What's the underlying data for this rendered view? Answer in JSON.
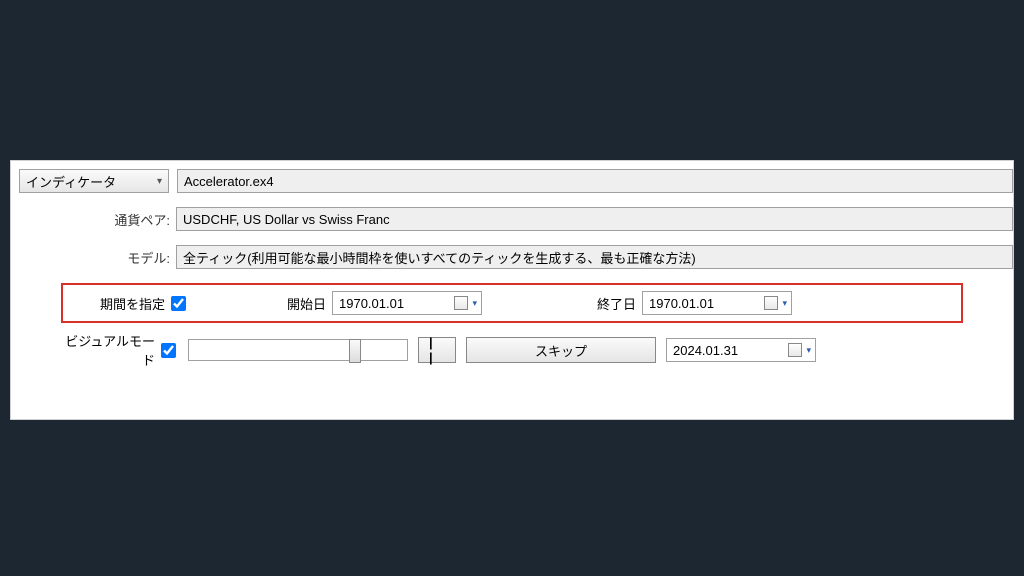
{
  "indicator": {
    "label": "インディケータ",
    "file": "Accelerator.ex4"
  },
  "pair": {
    "label": "通貨ペア:",
    "value": "USDCHF, US Dollar vs Swiss Franc"
  },
  "model": {
    "label": "モデル:",
    "value": "全ティック(利用可能な最小時間枠を使いすべてのティックを生成する、最も正確な方法)"
  },
  "period": {
    "label": "期間を指定",
    "start_label": "開始日",
    "start_value": "1970.01.01",
    "end_label": "終了日",
    "end_value": "1970.01.01"
  },
  "visual": {
    "label": "ビジュアルモード",
    "pause": "| |",
    "skip": "スキップ",
    "date": "2024.01.31"
  }
}
